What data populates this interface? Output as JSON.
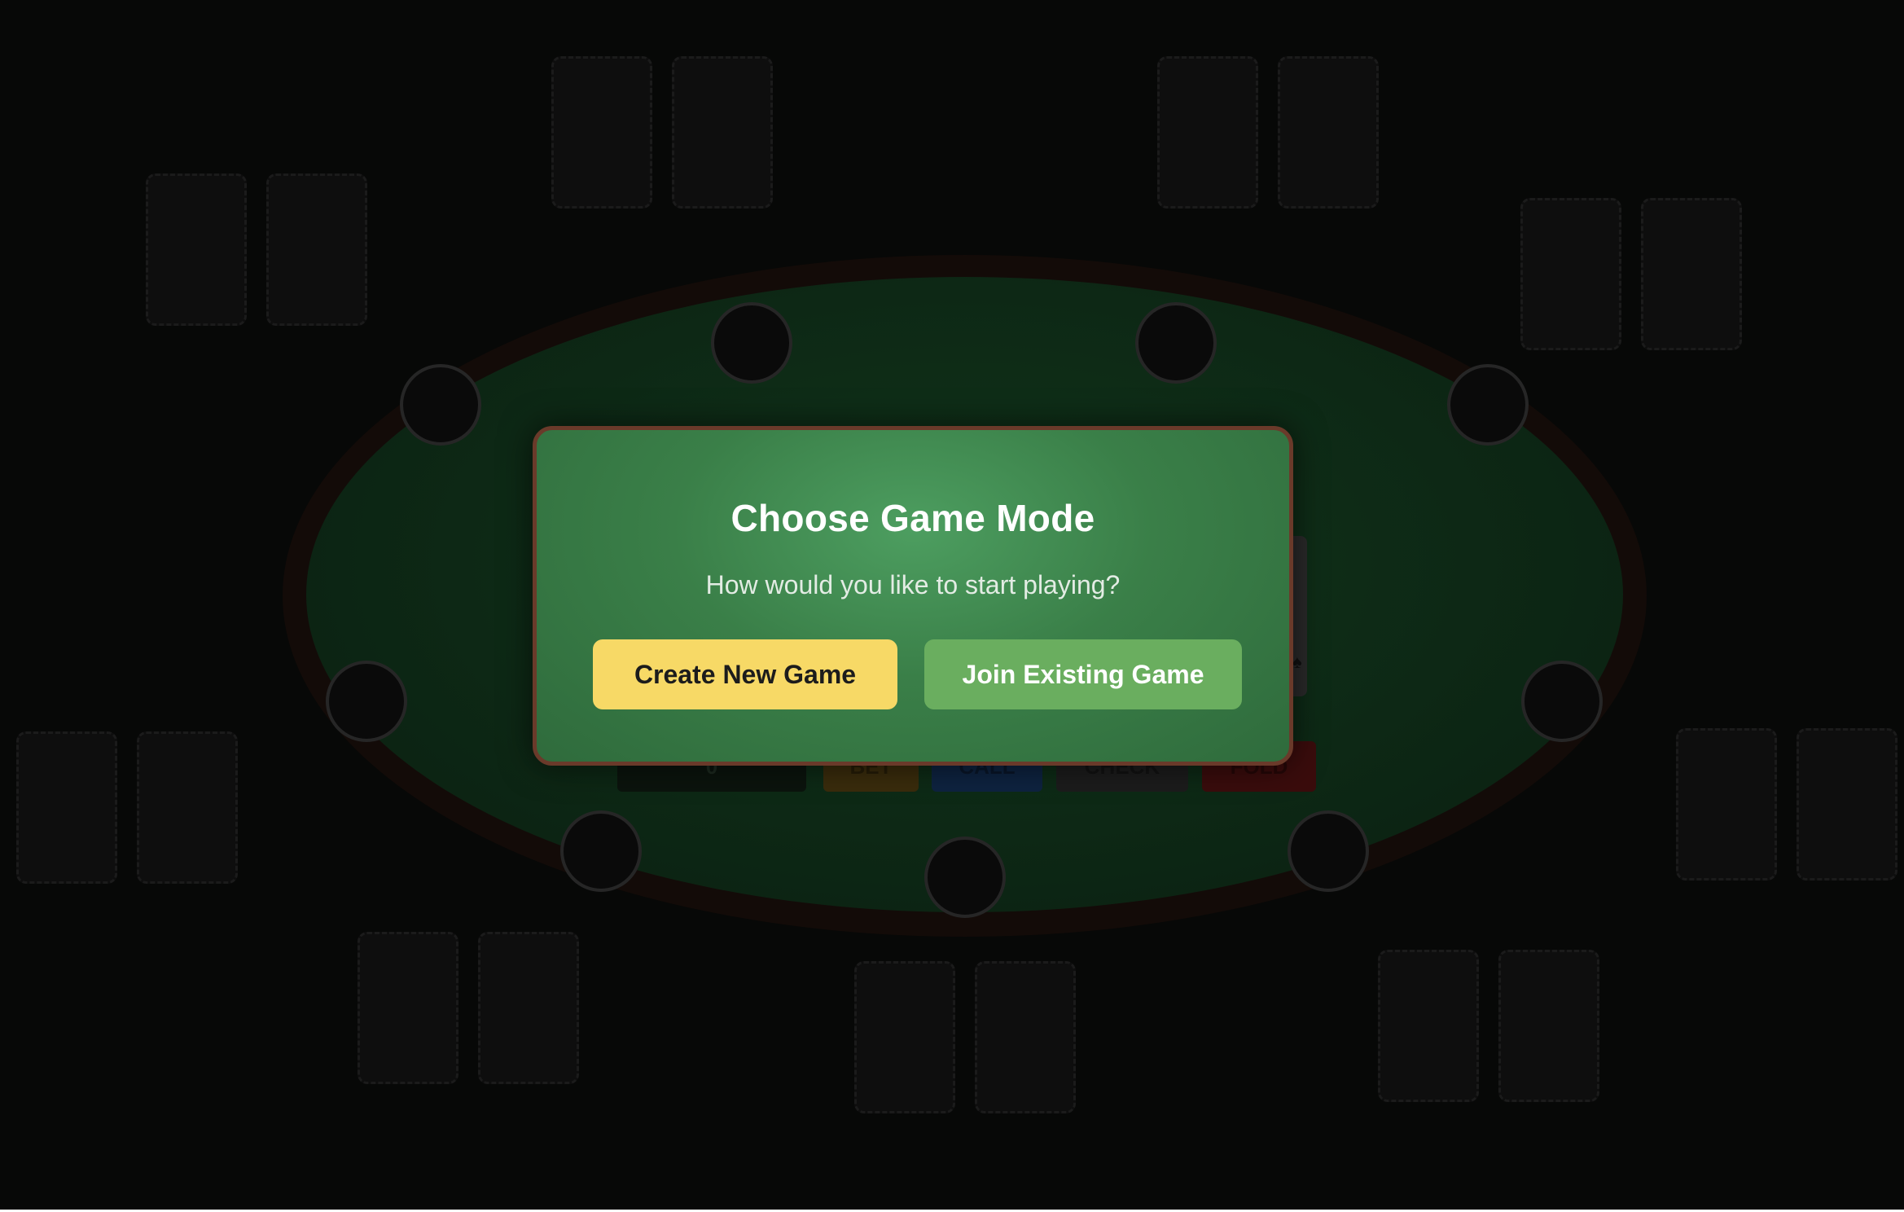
{
  "modal": {
    "title": "Choose Game Mode",
    "subtitle": "How would you like to start playing?",
    "create_label": "Create New Game",
    "join_label": "Join Existing Game"
  },
  "controls": {
    "amount_value": "0",
    "bet_label": "BET",
    "call_label": "CALL",
    "check_label": "CHECK",
    "fold_label": "FOLD"
  },
  "colors": {
    "felt": "#10351a",
    "rim": "#130b08",
    "modal_bg": "#3a7f48",
    "modal_border": "#6a3a2a",
    "create_button": "#f7d966",
    "join_button": "#6aae5f"
  }
}
